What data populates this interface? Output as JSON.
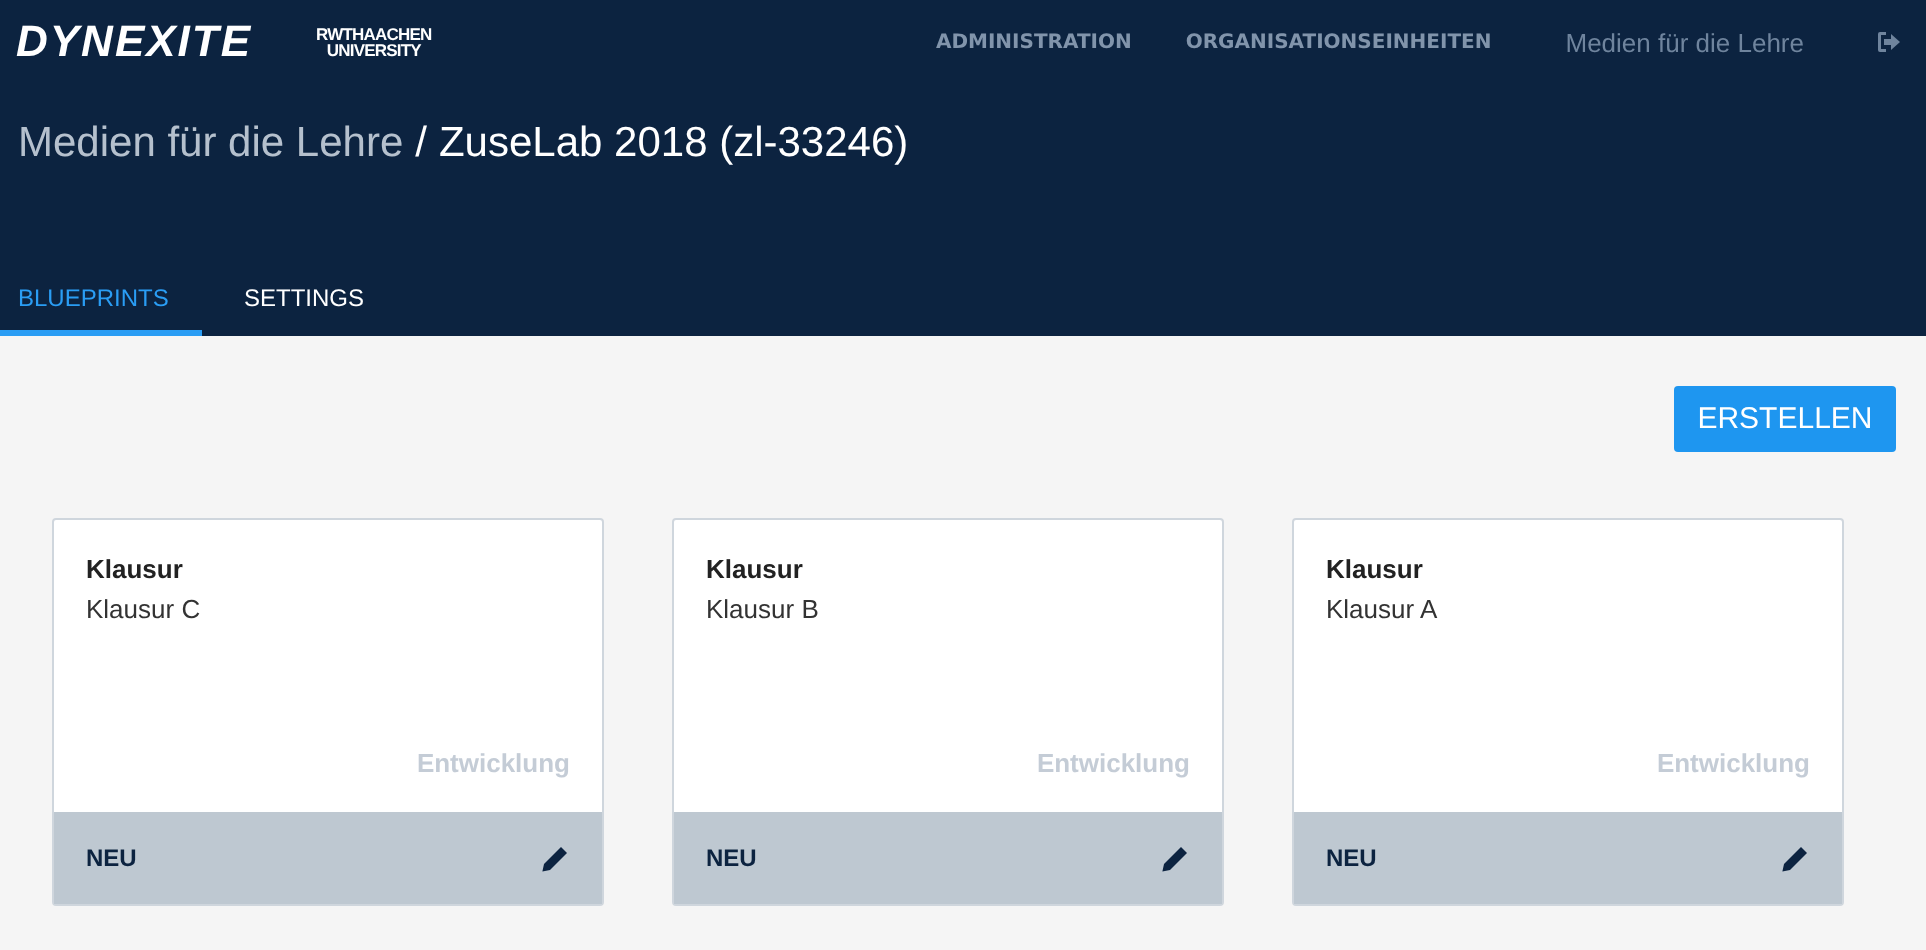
{
  "header": {
    "logo": "DYNEXITE",
    "university_logo": [
      "RWTHAACHEN",
      "UNIVERSITY"
    ],
    "nav": [
      {
        "label": "ADMINISTRATION",
        "kind": "link"
      },
      {
        "label": "ORGANISATIONSEINHEITEN",
        "kind": "link"
      },
      {
        "label": "Medien für die Lehre",
        "kind": "context"
      }
    ]
  },
  "breadcrumb": {
    "parent": "Medien für die Lehre",
    "separator": "/",
    "current": "ZuseLab 2018 (zl-33246)"
  },
  "tabs": [
    {
      "label": "BLUEPRINTS",
      "selected": true
    },
    {
      "label": "SETTINGS",
      "selected": false
    }
  ],
  "create_button": "ERSTELLEN",
  "cards": [
    {
      "type": "Klausur",
      "name": "Klausur C",
      "stage": "Entwicklung",
      "status": "NEU"
    },
    {
      "type": "Klausur",
      "name": "Klausur B",
      "stage": "Entwicklung",
      "status": "NEU"
    },
    {
      "type": "Klausur",
      "name": "Klausur A",
      "stage": "Entwicklung",
      "status": "NEU"
    }
  ]
}
